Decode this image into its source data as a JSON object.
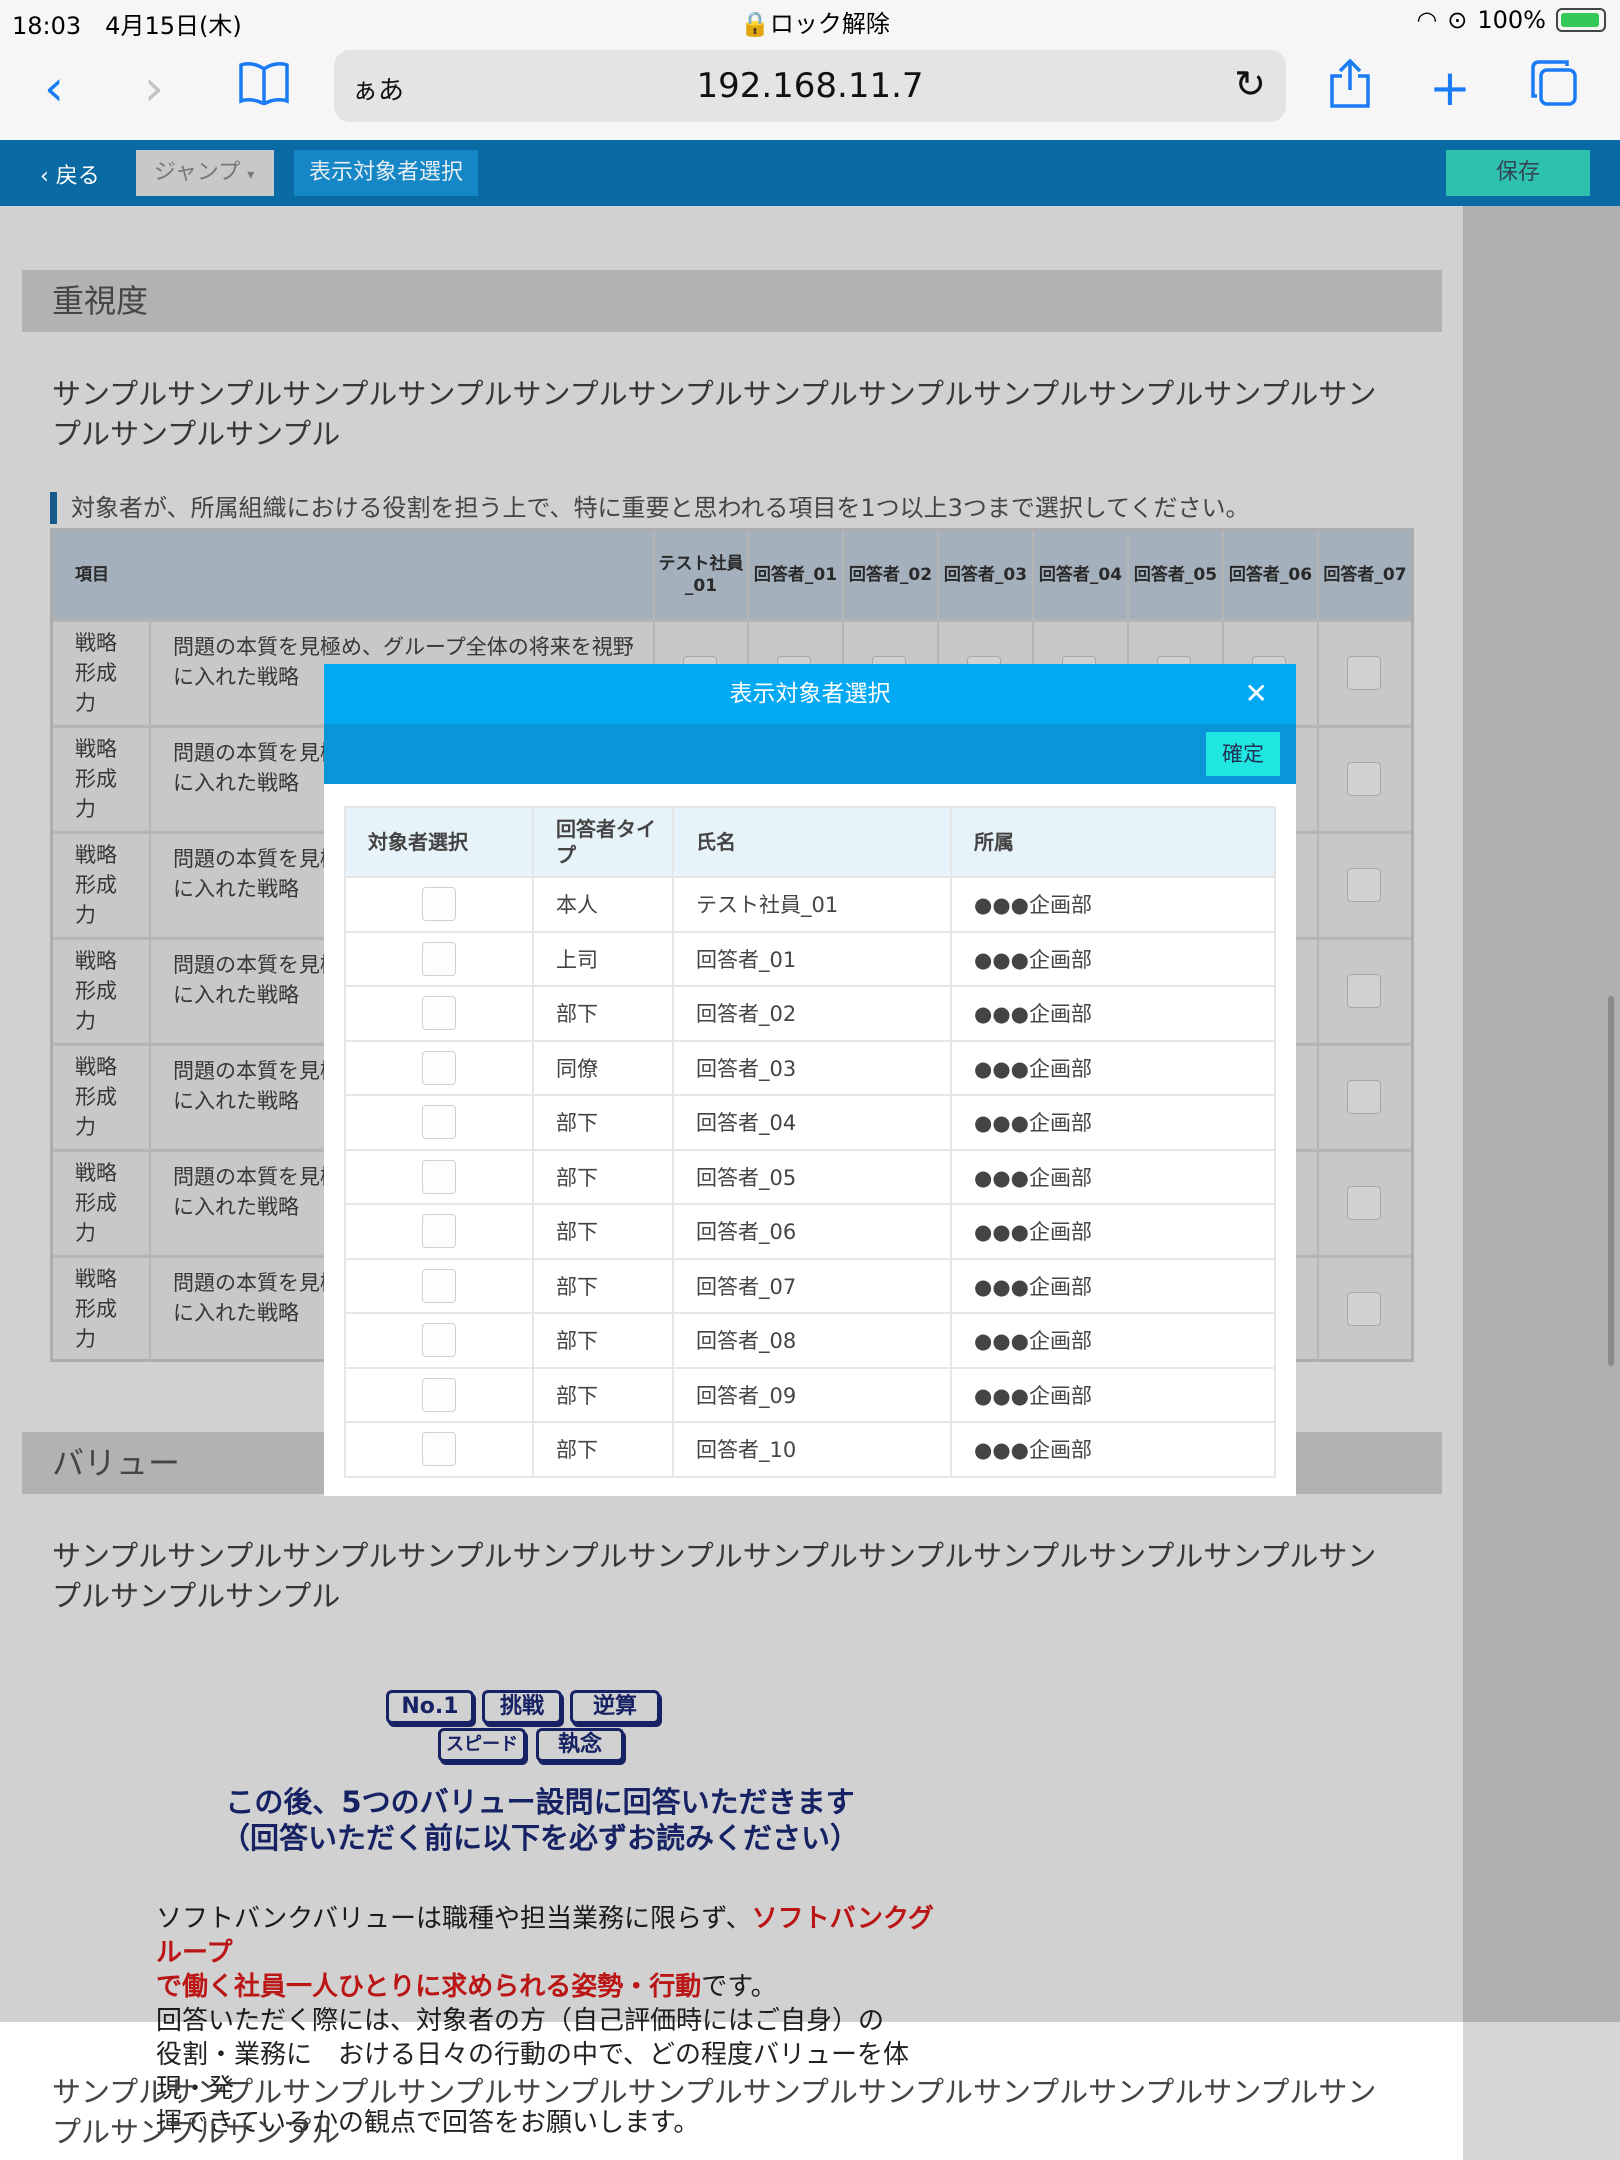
{
  "status_bar": {
    "time": "18:03",
    "date": "4月15日(木)",
    "center": "ロック解除",
    "battery": "100%"
  },
  "browser": {
    "aa_label": "ぁあ",
    "url": "192.168.11.7"
  },
  "appbar": {
    "back_label": "戻る",
    "jump_label": "ジャンプ",
    "select_target_label": "表示対象者選択",
    "save_label": "保存"
  },
  "section1": {
    "title": "重視度",
    "description": "サンプルサンプルサンプルサンプルサンプルサンプルサンプルサンプルサンプルサンプルサンプルサンプルサンプルサンプル",
    "instruction": "対象者が、所属組織における役割を担う上で、特に重要と思われる項目を1つ以上3つまで選択してください。"
  },
  "question_table": {
    "item_header": "項目",
    "respondent_headers": [
      "テスト社員_01",
      "回答者_01",
      "回答者_02",
      "回答者_03",
      "回答者_04",
      "回答者_05",
      "回答者_06",
      "回答者_07"
    ],
    "rows": [
      {
        "category": "戦略形成力",
        "text": "問題の本質を見極め、グループ全体の将来を視野に入れた戦略"
      },
      {
        "category": "戦略形成力",
        "text": "問題の本質を見極め、グループ全体の将来を視野に入れた戦略"
      },
      {
        "category": "戦略形成力",
        "text": "問題の本質を見極め、グループ全体の将来を視野に入れた戦略"
      },
      {
        "category": "戦略形成力",
        "text": "問題の本質を見極め、グループ全体の将来を視野に入れた戦略"
      },
      {
        "category": "戦略形成力",
        "text": "問題の本質を見極め、グループ全体の将来を視野に入れた戦略"
      },
      {
        "category": "戦略形成力",
        "text": "問題の本質を見極め、グループ全体の将来を視野に入れた戦略"
      },
      {
        "category": "戦略形成力",
        "text": "問題の本質を見極め、グループ全体の将来を視野に入れた戦略"
      }
    ]
  },
  "section2": {
    "title": "バリュー",
    "description": "サンプルサンプルサンプルサンプルサンプルサンプルサンプルサンプルサンプルサンプルサンプルサンプルサンプルサンプル"
  },
  "banner": {
    "tags": [
      "No.1",
      "挑戦",
      "逆算",
      "スピード",
      "執念"
    ],
    "headline_1": "この後、5つのバリュー設問に回答いただきます",
    "headline_2": "（回答いただく前に以下を必ずお読みください）",
    "body_1": "ソフトバンクバリューは職種や担当業務に限らず、",
    "body_red_1": "ソフトバンクグループ",
    "body_red_2": "で働く社員一人ひとりに求められる姿勢・行動",
    "body_2": "です。",
    "body_3": "回答いただく際には、対象者の方（自己評価時にはご自身）の",
    "body_4": "役割・業務に　おける日々の行動の中で、どの程度バリューを体現・発",
    "body_5": "揮できているかの観点で回答をお願いします。"
  },
  "bottom_description": "サンプルサンプルサンプルサンプルサンプルサンプルサンプルサンプルサンプルサンプルサンプルサンプルサンプルサンプル",
  "modal": {
    "title": "表示対象者選択",
    "confirm_label": "確定",
    "headers": {
      "select": "対象者選択",
      "type": "回答者タイプ",
      "name": "氏名",
      "dept": "所属"
    },
    "rows": [
      {
        "type": "本人",
        "name": "テスト社員_01",
        "dept": "●●●企画部"
      },
      {
        "type": "上司",
        "name": "回答者_01",
        "dept": "●●●企画部"
      },
      {
        "type": "部下",
        "name": "回答者_02",
        "dept": "●●●企画部"
      },
      {
        "type": "同僚",
        "name": "回答者_03",
        "dept": "●●●企画部"
      },
      {
        "type": "部下",
        "name": "回答者_04",
        "dept": "●●●企画部"
      },
      {
        "type": "部下",
        "name": "回答者_05",
        "dept": "●●●企画部"
      },
      {
        "type": "部下",
        "name": "回答者_06",
        "dept": "●●●企画部"
      },
      {
        "type": "部下",
        "name": "回答者_07",
        "dept": "●●●企画部"
      },
      {
        "type": "部下",
        "name": "回答者_08",
        "dept": "●●●企画部"
      },
      {
        "type": "部下",
        "name": "回答者_09",
        "dept": "●●●企画部"
      },
      {
        "type": "部下",
        "name": "回答者_10",
        "dept": "●●●企画部"
      }
    ]
  }
}
